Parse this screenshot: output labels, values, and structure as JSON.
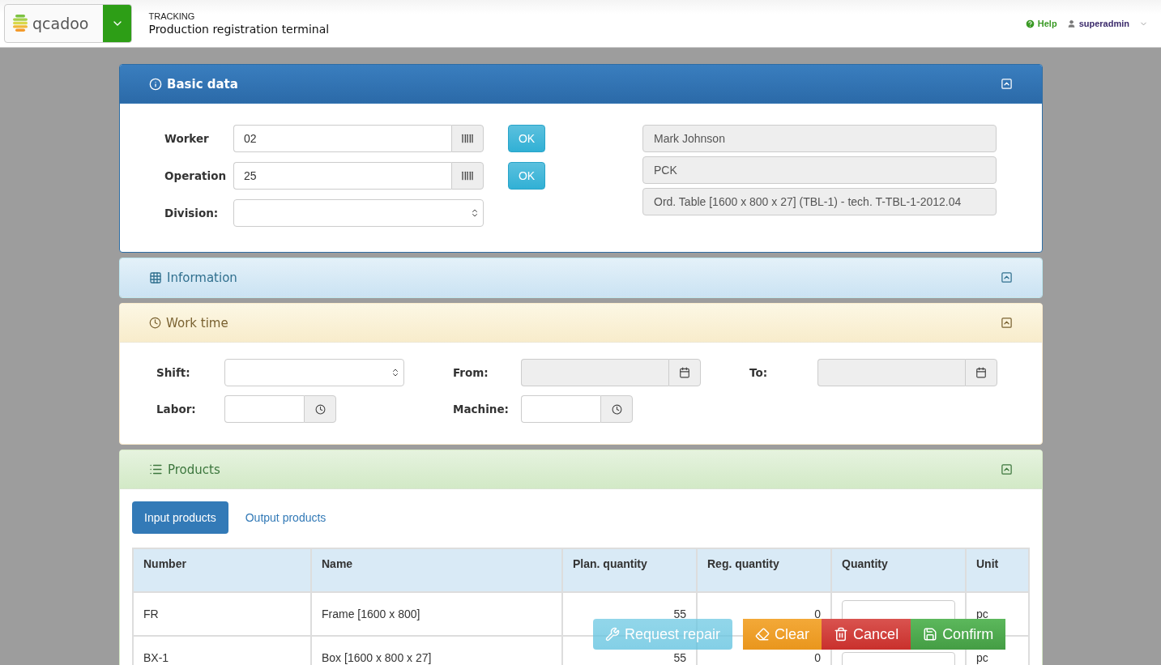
{
  "header": {
    "logo": "qcadoo",
    "section": "TRACKING",
    "title": "Production registration terminal",
    "help": "Help",
    "user": "superadmin"
  },
  "panels": [
    {
      "kind": "basic",
      "title": "Basic data",
      "expanded": true,
      "rows": [
        {
          "label": "Worker",
          "kind": "scan",
          "value": "02",
          "button": "OK"
        },
        {
          "label": "Operation",
          "kind": "scan",
          "value": "25",
          "button": "OK"
        },
        {
          "label": "Division:",
          "kind": "select"
        }
      ],
      "info": [
        "Mark Johnson",
        "PCK",
        "Ord. Table [1600 x 800 x 27] (TBL-1) - tech. T-TBL-1-2012.04"
      ]
    },
    {
      "kind": "info",
      "title": "Information",
      "expanded": false
    },
    {
      "kind": "worktime",
      "title": "Work time",
      "expanded": true,
      "fields": [
        {
          "label": "Shift:",
          "kind": "select"
        },
        {
          "label": "From:",
          "kind": "date",
          "disabled": true
        },
        {
          "label": "To:",
          "kind": "date",
          "disabled": true
        },
        {
          "label": "Labor:",
          "kind": "time",
          "disabled": false
        },
        {
          "label": "Machine:",
          "kind": "time",
          "disabled": false
        }
      ]
    },
    {
      "kind": "products",
      "title": "Products",
      "expanded": true,
      "tabs": [
        {
          "label": "Input products",
          "selected": true
        },
        {
          "label": "Output products",
          "selected": false
        }
      ],
      "table": {
        "columns": [
          "Number",
          "Name",
          "Plan. quantity",
          "Reg. quantity",
          "Quantity",
          "Unit"
        ],
        "rows": [
          [
            "FR",
            "Frame [1600 x 800]",
            "55",
            "0",
            null,
            "pc"
          ],
          [
            "BX-1",
            "Box [1600 x 800 x 27]",
            "55",
            "0",
            null,
            "pc"
          ]
        ]
      }
    }
  ],
  "actions": [
    {
      "kind": "repair",
      "label": "Request repair",
      "disabled": true
    },
    {
      "kind": "clear",
      "label": "Clear",
      "disabled": false
    },
    {
      "kind": "cancel",
      "label": "Cancel",
      "disabled": false
    },
    {
      "kind": "confirm",
      "label": "Confirm",
      "disabled": false
    }
  ]
}
